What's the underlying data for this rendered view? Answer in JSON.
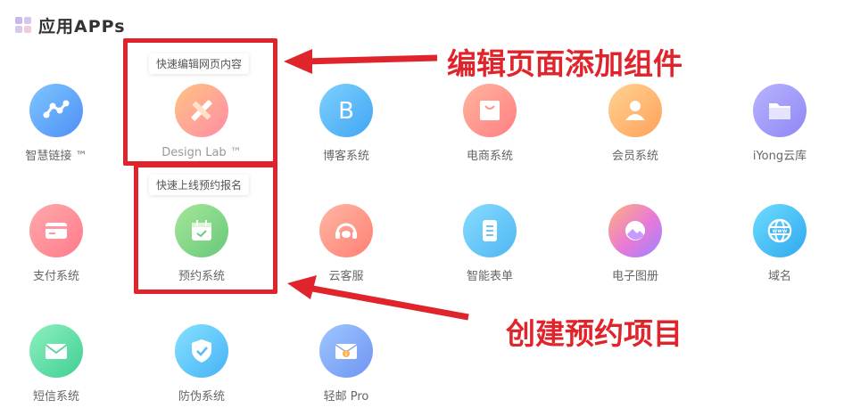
{
  "header": {
    "title": "应用APPs",
    "icon": "apps-grid-icon"
  },
  "apps": [
    {
      "label": "智慧链接 ™",
      "icon": "link-nodes-icon",
      "color_from": "#7cc6ff",
      "color_to": "#4f8ff6"
    },
    {
      "label": "Design Lab ™",
      "icon": "pencil-ruler-icon",
      "color_from": "#ffc383",
      "color_to": "#ff8ca6",
      "hovered": true
    },
    {
      "label": "博客系统",
      "icon": "blog-b-icon",
      "color_from": "#7fd0ff",
      "color_to": "#3fa6f3"
    },
    {
      "label": "电商系统",
      "icon": "shopping-bag-icon",
      "color_from": "#ffb49e",
      "color_to": "#ff7f82"
    },
    {
      "label": "会员系统",
      "icon": "user-icon",
      "color_from": "#ffd292",
      "color_to": "#ffa25a"
    },
    {
      "label": "iYong云库",
      "icon": "folder-icon",
      "color_from": "#b8b4ff",
      "color_to": "#8f87f4"
    },
    {
      "label": "支付系统",
      "icon": "payment-card-icon",
      "color_from": "#ffaaaa",
      "color_to": "#ff7a8c"
    },
    {
      "label": "预约系统",
      "icon": "calendar-icon",
      "color_from": "#a5e79a",
      "color_to": "#68c879",
      "hovered": true
    },
    {
      "label": "云客服",
      "icon": "headset-icon",
      "color_from": "#ffb7a3",
      "color_to": "#ff7f74"
    },
    {
      "label": "智能表单",
      "icon": "form-document-icon",
      "color_from": "#86dcff",
      "color_to": "#4fb6f2"
    },
    {
      "label": "电子图册",
      "icon": "photo-album-icon",
      "color_from": "#ffb07a",
      "color_to": "#c27cff"
    },
    {
      "label": "域名",
      "icon": "www-globe-icon",
      "color_from": "#6ddcff",
      "color_to": "#2fa8ee"
    },
    {
      "label": "短信系统",
      "icon": "envelope-icon",
      "color_from": "#8ef0c0",
      "color_to": "#3fcf93"
    },
    {
      "label": "防伪系统",
      "icon": "shield-check-icon",
      "color_from": "#86e1ff",
      "color_to": "#46b2f5"
    },
    {
      "label": "轻邮 Pro",
      "icon": "mail-info-icon",
      "color_from": "#9fc6ff",
      "color_to": "#6e95f2"
    }
  ],
  "tooltips": {
    "design_lab": "快速编辑网页内容",
    "booking": "快速上线预约报名"
  },
  "annotations": {
    "top": "编辑页面添加组件",
    "bottom": "创建预约项目",
    "color": "#e0242c"
  }
}
